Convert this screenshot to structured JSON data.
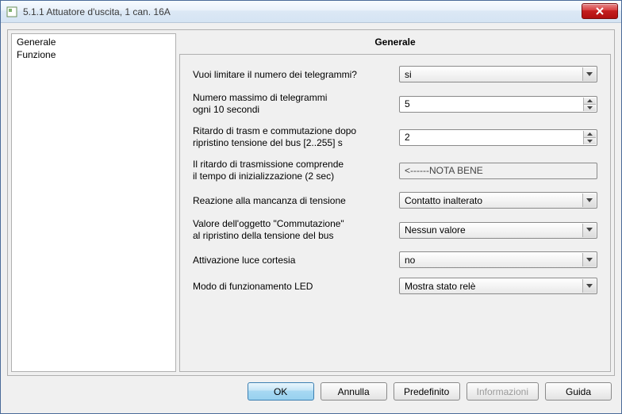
{
  "window": {
    "title": "5.1.1 Attuatore d'uscita, 1 can. 16A"
  },
  "sidebar": {
    "items": [
      "Generale",
      "Funzione"
    ]
  },
  "panel": {
    "header": "Generale",
    "rows": {
      "limit_telegrams": {
        "label": "Vuoi limitare il numero dei telegrammi?",
        "value": "si"
      },
      "max_telegrams": {
        "label_l1": "Numero massimo di telegrammi",
        "label_l2": "ogni 10 secondi",
        "value": "5"
      },
      "delay": {
        "label_l1": "Ritardo di trasm e commutazione dopo",
        "label_l2": "ripristino tensione del bus [2..255] s",
        "value": "2"
      },
      "note": {
        "label_l1": "Il ritardo di trasmissione comprende",
        "label_l2": "il tempo di inizializzazione (2 sec)",
        "value": "<------NOTA BENE"
      },
      "voltage_fail": {
        "label": "Reazione alla mancanza di tensione",
        "value": "Contatto inalterato"
      },
      "switch_value": {
        "label_l1": "Valore dell'oggetto \"Commutazione\"",
        "label_l2": "al ripristino della tensione del bus",
        "value": "Nessun valore"
      },
      "courtesy": {
        "label": "Attivazione luce cortesia",
        "value": "no"
      },
      "led_mode": {
        "label": "Modo di funzionamento LED",
        "value": "Mostra stato relè"
      }
    }
  },
  "buttons": {
    "ok": "OK",
    "cancel": "Annulla",
    "default": "Predefinito",
    "info": "Informazioni",
    "help": "Guida"
  }
}
